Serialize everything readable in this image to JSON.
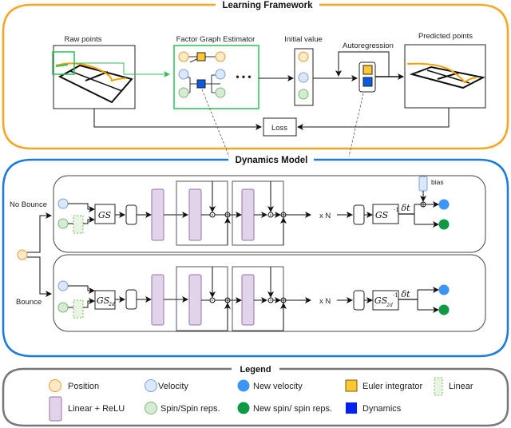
{
  "learning_framework": {
    "title": "Learning Framework",
    "raw_points_label": "Raw points",
    "factor_graph_label": "Factor Graph Estimator",
    "factor_graph_ellipsis": "• • •",
    "initial_value_label": "Initial value",
    "autoregression_label": "Autoregression",
    "predicted_points_label": "Predicted points",
    "loss_label": "Loss"
  },
  "dynamics_model": {
    "title": "Dynamics Model",
    "no_bounce": {
      "label": "No Bounce",
      "gs_label": "GS",
      "gs_inv_label": "GS",
      "gs_inv_sup": "-1",
      "repeat_label": "x N",
      "dt_label": "δt",
      "bias_label": "bias"
    },
    "bounce": {
      "label": "Bounce",
      "gs_label": "GS",
      "gs_sub": "2d",
      "gs_inv_label": "GS",
      "gs_inv_sub": "2d",
      "gs_inv_sup": "-1",
      "repeat_label": "x N",
      "dt_label": "δt"
    }
  },
  "legend": {
    "title": "Legend",
    "items": [
      {
        "label": "Position",
        "icon": "position-circle-icon"
      },
      {
        "label": "Velocity",
        "icon": "velocity-circle-icon"
      },
      {
        "label": "New velocity",
        "icon": "new-velocity-circle-icon"
      },
      {
        "label": "Euler integrator",
        "icon": "euler-integrator-square-icon"
      },
      {
        "label": "Linear",
        "icon": "linear-dashed-rect-icon"
      },
      {
        "label": "Linear + ReLU",
        "icon": "linear-relu-rect-icon"
      },
      {
        "label": "Spin/Spin reps.",
        "icon": "spin-circle-icon"
      },
      {
        "label": "New spin/ spin reps.",
        "icon": "new-spin-circle-icon"
      },
      {
        "label": "Dynamics",
        "icon": "dynamics-square-icon"
      }
    ]
  },
  "colors": {
    "learning_frame": "#f5a623",
    "dynamics_frame": "#1a7ae0",
    "legend_frame": "#777777",
    "position_fill": "#fde9c7",
    "position_stroke": "#e0a030",
    "velocity_fill": "#dbe8fb",
    "velocity_stroke": "#7f9fd6",
    "spin_fill": "#d6ecd2",
    "spin_stroke": "#7fb877",
    "new_velocity": "#3c94f5",
    "new_spin": "#0e9a44",
    "euler": "#fdc830",
    "dynamics": "#0a5be0",
    "linear_relu_fill": "#e1d3ea",
    "linear_relu_stroke": "#9673a6",
    "linear_fill": "#e7f5e2",
    "linear_stroke": "#82b366",
    "fge_border": "#2ebd59",
    "trajectory": "#f5a000"
  }
}
